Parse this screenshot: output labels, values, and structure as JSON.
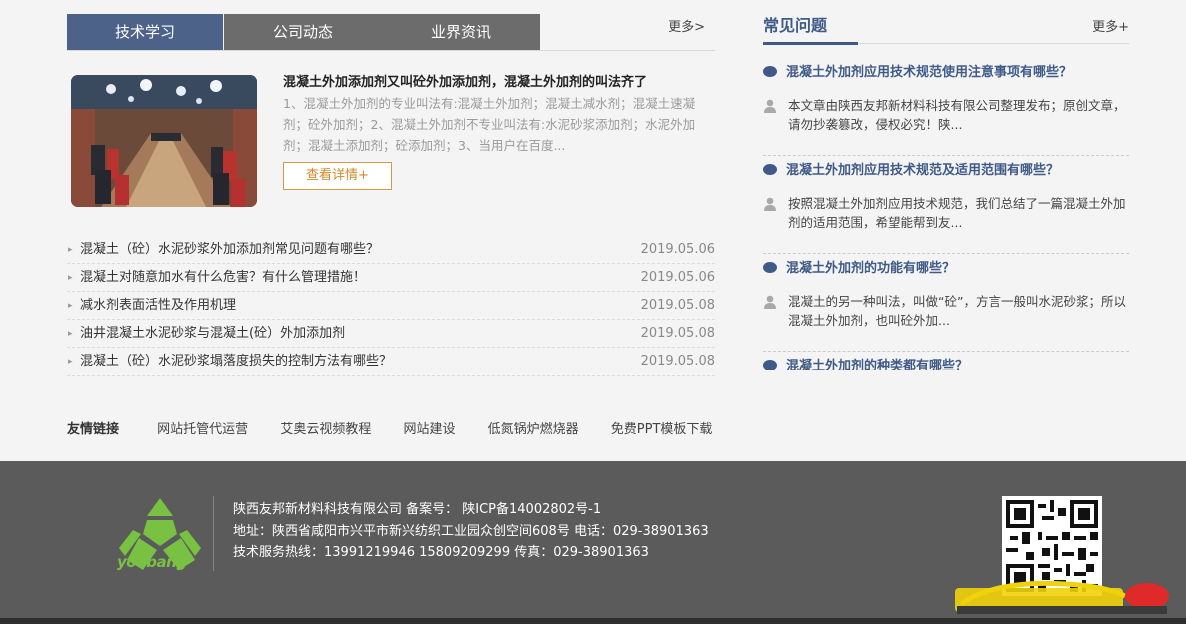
{
  "tabs": [
    {
      "label": "技术学习"
    },
    {
      "label": "公司动态"
    },
    {
      "label": "业界资讯"
    }
  ],
  "news_more": "更多>",
  "feature": {
    "title": "混凝土外加添加剂又叫砼外加添加剂，混凝土外加剂的叫法齐了",
    "desc": "1、混凝土外加剂的专业叫法有:混凝土外加剂；混凝土减水剂；混凝土速凝剂；砼外加剂；2、混凝土外加剂不专业叫法有:水泥砂浆添加剂；水泥外加剂；混凝土添加剂；砼添加剂；3、当用户在百度...",
    "button": "查看详情+"
  },
  "news": [
    {
      "title": "混凝土（砼）水泥砂浆外加添加剂常见问题有哪些？",
      "date": "2019.05.06"
    },
    {
      "title": "混凝土对随意加水有什么危害？有什么管理措施！",
      "date": "2019.05.06"
    },
    {
      "title": "减水剂表面活性及作用机理",
      "date": "2019.05.08"
    },
    {
      "title": "油井混凝土水泥砂浆与混凝土(砼）外加添加剂",
      "date": "2019.05.08"
    },
    {
      "title": "混凝土（砼）水泥砂浆塌落度损失的控制方法有哪些？",
      "date": "2019.05.08"
    }
  ],
  "friends": {
    "label": "友情链接",
    "links": [
      "网站托管代运营",
      "艾奥云视频教程",
      "网站建设",
      "低氮锅炉燃烧器",
      "免费PPT模板下载"
    ]
  },
  "faq": {
    "title": "常见问题",
    "more": "更多+",
    "items": [
      {
        "q": "混凝土外加剂应用技术规范使用注意事项有哪些？",
        "a": "本文章由陕西友邦新材料科技有限公司整理发布；原创文章，请勿抄袭篡改，侵权必究！陕..."
      },
      {
        "q": "混凝土外加剂应用技术规范及适用范围有哪些？",
        "a": "按照混凝土外加剂应用技术规范，我们总结了一篇混凝土外加剂的适用范围，希望能帮到友..."
      },
      {
        "q": "混凝土外加剂的功能有哪些？",
        "a": "混凝土的另一种叫法，叫做“砼”，方言一般叫水泥砂浆；所以混凝土外加剂，也叫砼外加..."
      },
      {
        "q": "混凝土外加剂的种类都有哪些？",
        "a": ""
      }
    ]
  },
  "footer": {
    "logo_text": "youbang",
    "line1": "陕西友邦新材料科技有限公司 备案号： 陕ICP备14002802号-1",
    "line2": "地址：陕西省咸阳市兴平市新兴纺织工业园众创空间608号    电话：029-38901363",
    "line3": "技术服务热线：13991219946 15809209299    传真：029-38901363"
  },
  "colors": {
    "tab_active": "#4c6288",
    "tab_inactive": "#6c6c6c",
    "accent_blue": "#3f5a87",
    "button_orange": "#cf8a2c",
    "footer_bg": "#5b5b5b",
    "logo_green": "#79c142"
  }
}
